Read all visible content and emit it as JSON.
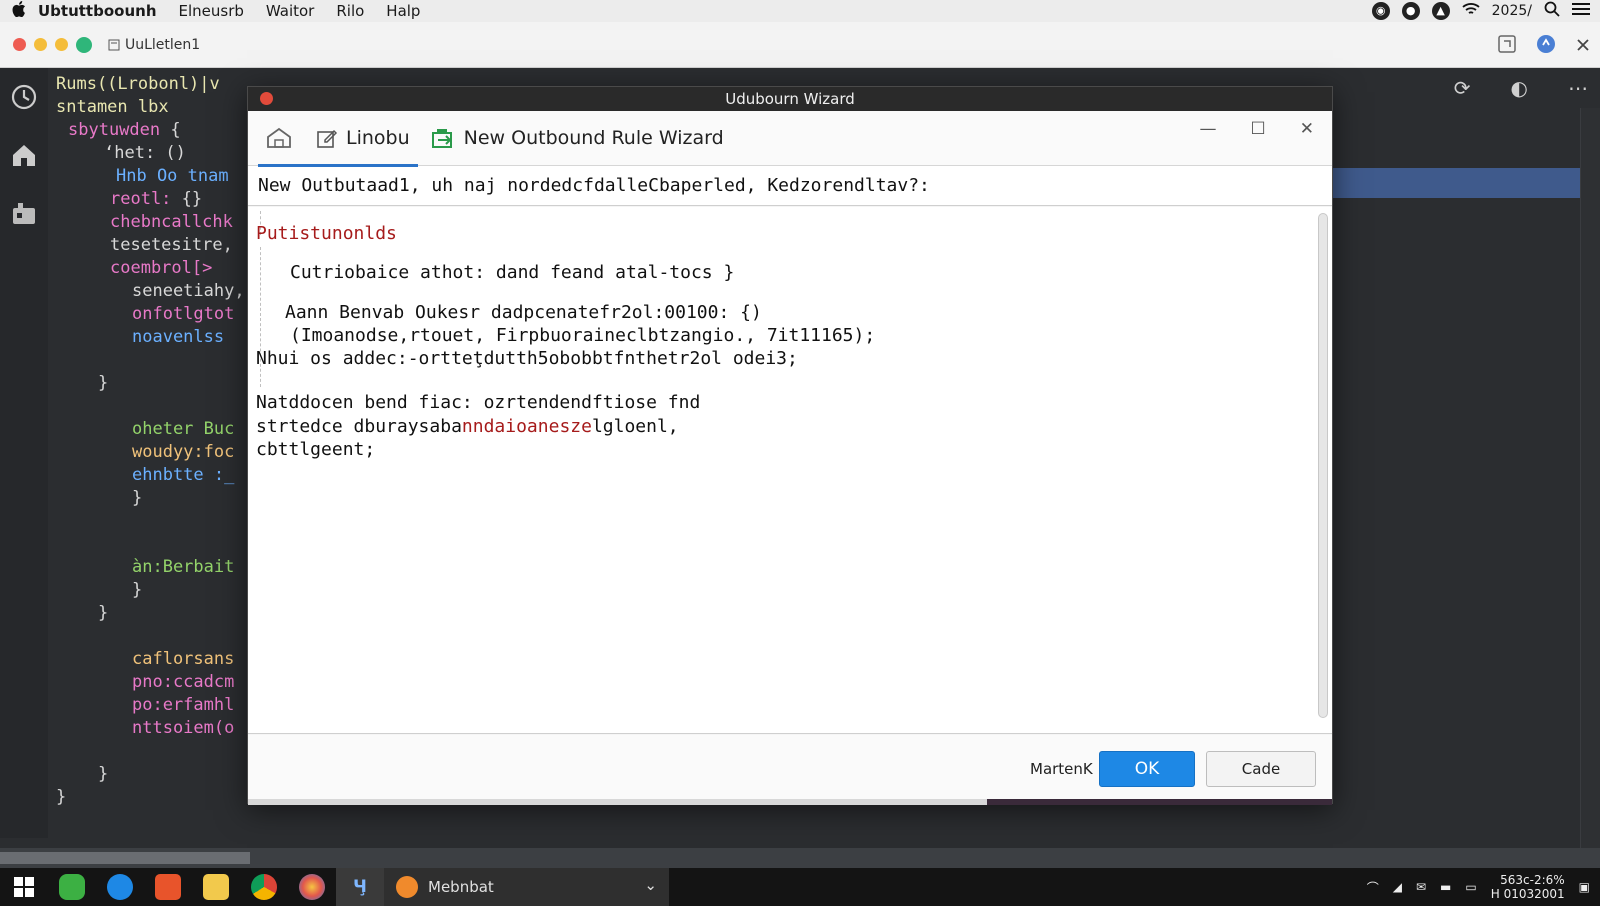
{
  "menubar": {
    "apple": "",
    "items": [
      "Ubtuttboounh",
      "Elneusrb",
      "Waitor",
      "Rilo",
      "Halp"
    ],
    "clock": "2025/",
    "icons": [
      "shield-icon",
      "chat-icon",
      "bell-icon",
      "wifi-icon",
      "search-icon",
      "menu-icon"
    ]
  },
  "window": {
    "doc_title": "UuLletlen1"
  },
  "editor": {
    "lines": [
      {
        "icon": "",
        "segs": [
          {
            "t": "Rums((Lrobonl)|v",
            "c": "c-y"
          }
        ]
      },
      {
        "icon": "",
        "segs": [
          {
            "t": "sntamen lbx ",
            "c": "c-y"
          }
        ]
      },
      {
        "icon": "▼",
        "segs": [
          {
            "t": "sbytuwden ",
            "c": "c-p"
          },
          {
            "t": "{",
            "c": "c-w"
          }
        ]
      },
      {
        "icon": "",
        "segs": [
          {
            "t": "ʻhet: ()",
            "c": "c-w"
          }
        ]
      },
      {
        "icon": "",
        "segs": [
          {
            "t": "Hnb Oo tnam",
            "c": "c-b"
          }
        ]
      },
      {
        "icon": "",
        "segs": [
          {
            "t": "reotl: ",
            "c": "c-p"
          },
          {
            "t": "{}",
            "c": "c-w"
          }
        ]
      },
      {
        "icon": "",
        "segs": [
          {
            "t": "chebncallchk",
            "c": "c-p"
          }
        ]
      },
      {
        "icon": "",
        "segs": [
          {
            "t": "tesetesitre,",
            "c": "c-w"
          }
        ]
      },
      {
        "icon": "",
        "segs": [
          {
            "t": "coembrol[>",
            "c": "c-p"
          }
        ]
      },
      {
        "icon": "",
        "segs": [
          {
            "t": "seneetiahy,",
            "c": "c-w"
          }
        ]
      },
      {
        "icon": "",
        "segs": [
          {
            "t": "onfotlgtot",
            "c": "c-p"
          }
        ]
      },
      {
        "icon": "",
        "segs": [
          {
            "t": "noavenlss",
            "c": "c-b"
          }
        ]
      },
      {
        "icon": "",
        "segs": [
          {
            "t": "",
            "c": "c-w"
          }
        ]
      },
      {
        "icon": "",
        "segs": [
          {
            "t": "}",
            "c": "c-w"
          }
        ]
      },
      {
        "icon": "",
        "segs": [
          {
            "t": "",
            "c": "c-w"
          }
        ]
      },
      {
        "icon": "",
        "segs": [
          {
            "t": "oheter Buc",
            "c": "c-g"
          }
        ]
      },
      {
        "icon": "",
        "segs": [
          {
            "t": "woudyy:foc",
            "c": "c-o"
          }
        ]
      },
      {
        "icon": "",
        "segs": [
          {
            "t": "ehnbtte :_",
            "c": "c-b"
          }
        ]
      },
      {
        "icon": "",
        "segs": [
          {
            "t": "}",
            "c": "c-w"
          }
        ]
      },
      {
        "icon": "",
        "segs": [
          {
            "t": "",
            "c": "c-w"
          }
        ]
      },
      {
        "icon": "",
        "segs": [
          {
            "t": "",
            "c": "c-w"
          }
        ]
      },
      {
        "icon": "",
        "segs": [
          {
            "t": "àn:Berbait",
            "c": "c-g"
          }
        ]
      },
      {
        "icon": "",
        "segs": [
          {
            "t": "}",
            "c": "c-w"
          }
        ]
      },
      {
        "icon": "",
        "segs": [
          {
            "t": "}",
            "c": "c-w"
          }
        ]
      },
      {
        "icon": "",
        "segs": [
          {
            "t": "",
            "c": "c-w"
          }
        ]
      },
      {
        "icon": "",
        "segs": [
          {
            "t": "caflorsans",
            "c": "c-o"
          }
        ]
      },
      {
        "icon": "",
        "segs": [
          {
            "t": "pno:ccadcm",
            "c": "c-p"
          }
        ]
      },
      {
        "icon": "",
        "segs": [
          {
            "t": "po:erfamhl",
            "c": "c-p"
          }
        ]
      },
      {
        "icon": "",
        "segs": [
          {
            "t": "nttsoiem(o",
            "c": "c-p"
          }
        ]
      },
      {
        "icon": "",
        "segs": [
          {
            "t": "",
            "c": "c-w"
          }
        ]
      },
      {
        "icon": "",
        "segs": [
          {
            "t": "}",
            "c": "c-w"
          }
        ]
      },
      {
        "icon": "",
        "segs": [
          {
            "t": "}",
            "c": "c-w"
          }
        ]
      }
    ]
  },
  "dialog": {
    "title": "Udubourn Wizard",
    "tabs": [
      {
        "label": "",
        "icon": "home-icon"
      },
      {
        "label": "Linobu",
        "icon": "edit-icon"
      },
      {
        "label": "New Outbound Rule Wizard",
        "icon": "rule-icon"
      }
    ],
    "prompt": "New Outbutaad1, uh naj nordedcfdalleCbaperled, Kedzorendltav?:",
    "body": {
      "heading": "Putistunonlds",
      "line1": "Cutriobaice athot: dand feand atal-tocs }",
      "line2": "Aann Benvab Oukesr dadpcenatefr2ol:00100: {)",
      "line3": "(Imoanodse,rtouet, Firpbuoraineclbtzangio., 7it11165);",
      "line4": "Nhui os addec:-ortteţdutth5obobbtfnthetr2ol odei3;",
      "line5": "Natddocen bend fiac: ozrtendendftiose fnd",
      "line6a": "strtedce dburaysaba",
      "line6b": "nndaioanesze",
      "line6c": "lgloenl,",
      "line7": "cbttlgeent;"
    },
    "footer": {
      "left_label": "MartenK",
      "ok": "OK",
      "cancel": "Cade"
    }
  },
  "taskbar": {
    "active_app": "Mebnbat",
    "clock_line1": "563c-2:6%",
    "clock_line2": "H 01032001"
  }
}
